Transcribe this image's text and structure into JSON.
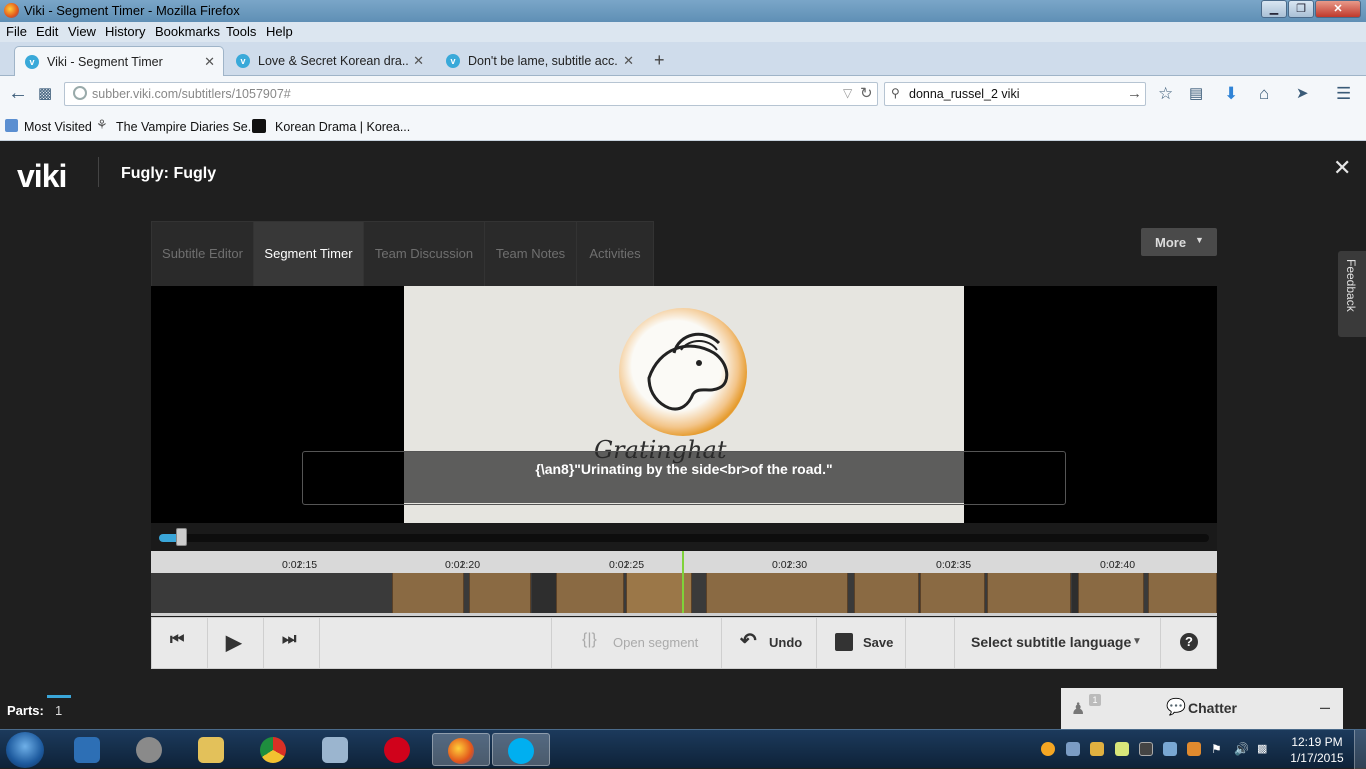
{
  "window": {
    "title": "Viki - Segment Timer - Mozilla Firefox",
    "min_label": "▁",
    "max_label": "❐",
    "close_label": "✕"
  },
  "menu": [
    "File",
    "Edit",
    "View",
    "History",
    "Bookmarks",
    "Tools",
    "Help"
  ],
  "tabs": [
    {
      "label": "Viki - Segment Timer",
      "active": true
    },
    {
      "label": "Love & Secret Korean dra...",
      "active": false
    },
    {
      "label": "Don't be lame, subtitle acc...",
      "active": false
    }
  ],
  "new_tab_label": "+",
  "nav": {
    "url": "subber.viki.com/subtitlers/1057907#",
    "search_value": "donna_russel_2 viki"
  },
  "bookmarks": [
    "Most Visited",
    "The Vampire Diaries Se...",
    "Korean Drama | Korea..."
  ],
  "app": {
    "logo": "viki",
    "show_title": "Fugly: Fugly",
    "close": "✕",
    "editor_tabs": [
      {
        "label": "Subtitle Editor",
        "active": false
      },
      {
        "label": "Segment Timer",
        "active": true
      },
      {
        "label": "Team Discussion",
        "active": false
      },
      {
        "label": "Team Notes",
        "active": false
      },
      {
        "label": "Activities",
        "active": false
      }
    ],
    "more_label": "More",
    "subtitle_text": "{\\an8}\"Urinating by the side<br>of the road.\"",
    "video_logo_text": "Gratinghat",
    "playback_progress_fraction": 0.02,
    "timeline_labels": [
      "0:02:15",
      "0:02:20",
      "0:02:25",
      "0:02:30",
      "0:02:35",
      "0:02:40"
    ],
    "controls": {
      "open_segment": "Open segment",
      "undo": "Undo",
      "save": "Save",
      "language": "Select subtitle language",
      "help": "?"
    },
    "parts_label": "Parts:",
    "parts_value": "1",
    "chatter_label": "Chatter",
    "chatter_badge": "1",
    "feedback_label": "Feedback"
  },
  "taskbar": {
    "time": "12:19 PM",
    "date": "1/17/2015"
  },
  "colors": {
    "accent": "#3aa6d9",
    "segment": "#8a6a43",
    "playhead": "#7fd23a"
  }
}
